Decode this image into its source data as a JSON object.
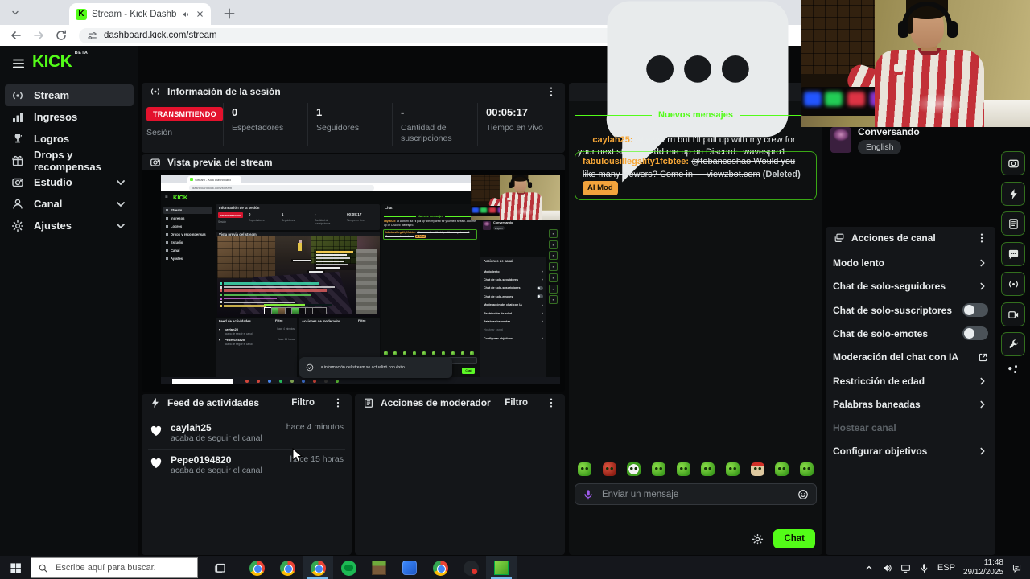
{
  "browser": {
    "tab_title": "Stream - Kick Dashboard",
    "url": "dashboard.kick.com/stream"
  },
  "sidebar": {
    "logo": "KICK",
    "beta": "BETA",
    "items": [
      {
        "label": "Stream"
      },
      {
        "label": "Ingresos"
      },
      {
        "label": "Logros"
      },
      {
        "label": "Drops y recompensas"
      },
      {
        "label": "Estudio"
      },
      {
        "label": "Canal"
      },
      {
        "label": "Ajustes"
      }
    ]
  },
  "session": {
    "title": "Información de la sesión",
    "live_badge": "TRANSMITIENDO",
    "session_label": "Sesión",
    "stats": [
      {
        "value": "0",
        "label": "Espectadores"
      },
      {
        "value": "1",
        "label": "Seguidores"
      },
      {
        "value": "-",
        "label": "Cantidad de suscripciones"
      },
      {
        "value": "00:05:17",
        "label": "Tiempo en vivo"
      }
    ]
  },
  "preview": {
    "title": "Vista previa del stream",
    "toast": "La información del stream se actualizó con éxito"
  },
  "activity_feed": {
    "title": "Feed de actividades",
    "filter_label": "Filtro",
    "items": [
      {
        "user": "caylah25",
        "action": "acaba de seguir el canal",
        "time": "hace 4 minutos"
      },
      {
        "user": "Pepe0194820",
        "action": "acaba de seguir el canal",
        "time": "hace 15 horas"
      }
    ]
  },
  "moderator_panel": {
    "title": "Acciones de moderador",
    "filter_label": "Filtro"
  },
  "chat": {
    "title": "Chat",
    "new_messages_divider": "Nuevos mensajes",
    "messages": [
      {
        "user": "caylah25",
        "text": "At work rn but I'll pull up with my crew for your next stream. Add me up on Discord:  wavespro1"
      },
      {
        "user": "fabulousillegality1fcbtee",
        "text": "@tebancoshao Would you like many viewers? Come in — viewzbot.com",
        "deleted_label": "(Deleted)",
        "mod_badge": "AI Mod"
      }
    ],
    "input_placeholder": "Enviar un mensaje",
    "send_button": "Chat",
    "emotes": [
      "halo",
      "rage",
      "clown",
      "smug",
      "raptor",
      "happy",
      "grin",
      "monkey-fez",
      "blush",
      "love"
    ]
  },
  "category": {
    "name": "Conversando",
    "tag": "English"
  },
  "channel_actions": {
    "title": "Acciones de canal",
    "items": [
      {
        "label": "Modo lento",
        "control": "chevron",
        "enabled": true
      },
      {
        "label": "Chat de solo-seguidores",
        "control": "chevron",
        "enabled": true
      },
      {
        "label": "Chat de solo-suscriptores",
        "control": "toggle",
        "state": false,
        "enabled": true
      },
      {
        "label": "Chat de solo-emotes",
        "control": "toggle",
        "state": false,
        "enabled": true
      },
      {
        "label": "Moderación del chat con IA",
        "control": "external",
        "enabled": true
      },
      {
        "label": "Restricción de edad",
        "control": "chevron",
        "enabled": true
      },
      {
        "label": "Palabras baneadas",
        "control": "chevron",
        "enabled": true
      },
      {
        "label": "Hostear canal",
        "control": "none",
        "enabled": false
      },
      {
        "label": "Configurar objetivos",
        "control": "chevron",
        "enabled": true
      }
    ]
  },
  "quick_actions": [
    "studio",
    "lightning",
    "notes",
    "chat",
    "broadcast",
    "clips",
    "wrench"
  ],
  "taskbar": {
    "search_placeholder": "Escribe aquí para buscar.",
    "apps": [
      "chrome",
      "chrome",
      "chrome",
      "spotify",
      "minecraft",
      "blue-app",
      "chrome",
      "dark-app",
      "minecraft-green"
    ],
    "active_apps": [
      2,
      8
    ],
    "language": "ESP",
    "time": "11:48",
    "date": "29/12/2025"
  },
  "colors": {
    "kick_green": "#53fc18",
    "live_red": "#e3122d",
    "username_orange": "#f7a737",
    "aimod_badge": "#f2a33c"
  }
}
